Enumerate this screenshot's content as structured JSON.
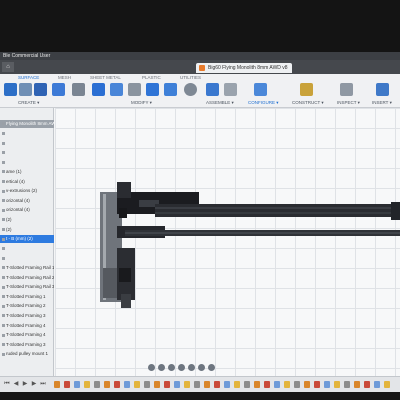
{
  "window": {
    "title": "Ble Commercial User"
  },
  "tabs": {
    "home_glyph": "⌂",
    "document_title": "Big60 Flying Monolith 8mm AWD v8"
  },
  "ribbon": {
    "tabs": [
      "SURFACE",
      "MESH",
      "SHEET METAL",
      "PLASTIC",
      "UTILITIES"
    ],
    "active_tab": "SURFACE",
    "groups": {
      "create": "CREATE ▾",
      "modify": "MODIFY ▾",
      "assemble": "ASSEMBLE ▾",
      "configure": "CONFIGURE ▾",
      "construct": "CONSTRUCT ▾",
      "inspect": "INSPECT ▾",
      "insert": "INSERT ▾"
    }
  },
  "browser": {
    "items": [
      "Flying Monolith 8mm AW",
      "",
      "",
      "",
      "",
      "ame (1)",
      "ertical (4)",
      "v-extrusions (2)",
      "orizontal (4)",
      "orizontal (4)",
      "(2)",
      "(2)",
      "t - B (mm) (2)",
      "",
      "",
      "T-Slotted Framing Rail 1",
      "T-Slotted Framing Rail 2",
      "T-Slotted Framing Rail 3",
      "T-Slotted Framing 1",
      "T-Slotted Framing 2",
      "T-Slotted Framing 3",
      "T-Slotted Framing 4",
      "T-Slotted Framing 4",
      "T-Slotted Framing 3",
      "ruded pulley mount 1"
    ],
    "root_index": 0,
    "selected_index": 12
  },
  "colors": {
    "accent": "#1f6fd1",
    "selection": "#2e7be0",
    "extrusion": "#2a2c31",
    "gantry": "#1b1c20"
  },
  "icons": {
    "ribbon_tools": [
      "surface-tool-icon",
      "patch-tool-icon",
      "extrude-icon",
      "loft-icon",
      "sweep-icon",
      "press-pull-icon",
      "fillet-icon",
      "shell-icon",
      "combine-icon",
      "move-icon",
      "joint-icon",
      "as-built-joint-icon",
      "parameters-icon",
      "offset-plane-icon",
      "measure-icon",
      "insert-image-icon"
    ],
    "nav": [
      "orbit-icon",
      "pan-icon",
      "zoom-icon",
      "fit-icon",
      "display-settings-icon",
      "grid-settings-icon",
      "viewports-icon"
    ]
  }
}
